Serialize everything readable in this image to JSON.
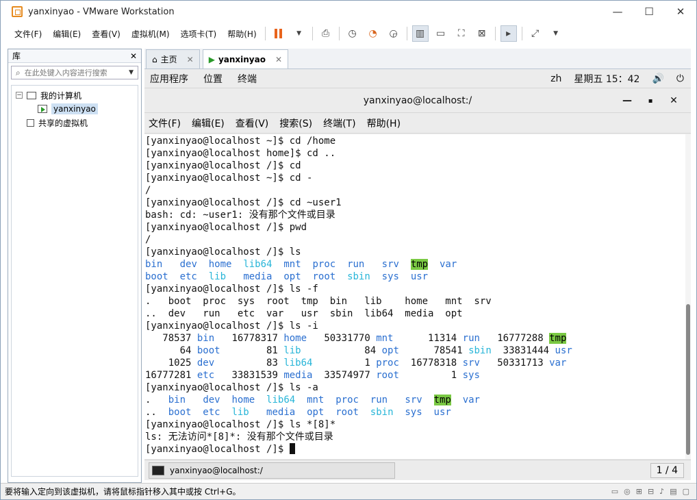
{
  "window": {
    "title": "yanxinyao - VMware Workstation"
  },
  "menubar": [
    "文件(F)",
    "编辑(E)",
    "查看(V)",
    "虚拟机(M)",
    "选项卡(T)",
    "帮助(H)"
  ],
  "library": {
    "title": "库",
    "search_placeholder": "在此处键入内容进行搜索",
    "tree": {
      "my_computer": "我的计算机",
      "vm": "yanxinyao",
      "shared": "共享的虚拟机"
    }
  },
  "tabs": [
    {
      "label": "主页"
    },
    {
      "label": "yanxinyao"
    }
  ],
  "gnome": {
    "apps": "应用程序",
    "places": "位置",
    "terminal": "终端",
    "lang": "zh",
    "clock": "星期五 15：42"
  },
  "terminal": {
    "title": "yanxinyao@localhost:/",
    "menu": [
      "文件(F)",
      "编辑(E)",
      "查看(V)",
      "搜索(S)",
      "终端(T)",
      "帮助(H)"
    ],
    "lines": [
      [
        {
          "t": "[yanxinyao@localhost ~]$ cd /home"
        }
      ],
      [
        {
          "t": "[yanxinyao@localhost home]$ cd .."
        }
      ],
      [
        {
          "t": "[yanxinyao@localhost /]$ cd"
        }
      ],
      [
        {
          "t": "[yanxinyao@localhost ~]$ cd -"
        }
      ],
      [
        {
          "t": "/"
        }
      ],
      [
        {
          "t": "[yanxinyao@localhost /]$ cd ~user1"
        }
      ],
      [
        {
          "t": "bash: cd: ~user1: 没有那个文件或目录"
        }
      ],
      [
        {
          "t": "[yanxinyao@localhost /]$ pwd"
        }
      ],
      [
        {
          "t": "/"
        }
      ],
      [
        {
          "t": "[yanxinyao@localhost /]$ ls"
        }
      ],
      [
        {
          "t": "bin",
          "c": "blue"
        },
        {
          "t": "   "
        },
        {
          "t": "dev",
          "c": "blue"
        },
        {
          "t": "  "
        },
        {
          "t": "home",
          "c": "blue"
        },
        {
          "t": "  "
        },
        {
          "t": "lib64",
          "c": "cyan"
        },
        {
          "t": "  "
        },
        {
          "t": "mnt",
          "c": "blue"
        },
        {
          "t": "  "
        },
        {
          "t": "proc",
          "c": "blue"
        },
        {
          "t": "  "
        },
        {
          "t": "run",
          "c": "blue"
        },
        {
          "t": "   "
        },
        {
          "t": "srv",
          "c": "blue"
        },
        {
          "t": "  "
        },
        {
          "t": "tmp",
          "c": "tmp"
        },
        {
          "t": "  "
        },
        {
          "t": "var",
          "c": "blue"
        }
      ],
      [
        {
          "t": "boot",
          "c": "blue"
        },
        {
          "t": "  "
        },
        {
          "t": "etc",
          "c": "blue"
        },
        {
          "t": "  "
        },
        {
          "t": "lib",
          "c": "cyan"
        },
        {
          "t": "   "
        },
        {
          "t": "media",
          "c": "blue"
        },
        {
          "t": "  "
        },
        {
          "t": "opt",
          "c": "blue"
        },
        {
          "t": "  "
        },
        {
          "t": "root",
          "c": "blue"
        },
        {
          "t": "  "
        },
        {
          "t": "sbin",
          "c": "cyan"
        },
        {
          "t": "  "
        },
        {
          "t": "sys",
          "c": "blue"
        },
        {
          "t": "  "
        },
        {
          "t": "usr",
          "c": "blue"
        }
      ],
      [
        {
          "t": "[yanxinyao@localhost /]$ ls -f"
        }
      ],
      [
        {
          "t": ".   boot  proc  sys  root  tmp  bin   lib    home   mnt  srv"
        }
      ],
      [
        {
          "t": "..  dev   run   etc  var   usr  sbin  lib64  media  opt"
        }
      ],
      [
        {
          "t": "[yanxinyao@localhost /]$ ls -i"
        }
      ],
      [
        {
          "t": "   78537 "
        },
        {
          "t": "bin",
          "c": "blue"
        },
        {
          "t": "   16778317 "
        },
        {
          "t": "home",
          "c": "blue"
        },
        {
          "t": "   50331770 "
        },
        {
          "t": "mnt",
          "c": "blue"
        },
        {
          "t": "      11314 "
        },
        {
          "t": "run",
          "c": "blue"
        },
        {
          "t": "   16777288 "
        },
        {
          "t": "tmp",
          "c": "tmp"
        }
      ],
      [
        {
          "t": "      64 "
        },
        {
          "t": "boot",
          "c": "blue"
        },
        {
          "t": "        81 "
        },
        {
          "t": "lib",
          "c": "cyan"
        },
        {
          "t": "           84 "
        },
        {
          "t": "opt",
          "c": "blue"
        },
        {
          "t": "      78541 "
        },
        {
          "t": "sbin",
          "c": "cyan"
        },
        {
          "t": "  33831444 "
        },
        {
          "t": "usr",
          "c": "blue"
        }
      ],
      [
        {
          "t": "    1025 "
        },
        {
          "t": "dev",
          "c": "blue"
        },
        {
          "t": "         83 "
        },
        {
          "t": "lib64",
          "c": "cyan"
        },
        {
          "t": "         1 "
        },
        {
          "t": "proc",
          "c": "blue"
        },
        {
          "t": "  16778318 "
        },
        {
          "t": "srv",
          "c": "blue"
        },
        {
          "t": "   50331713 "
        },
        {
          "t": "var",
          "c": "blue"
        }
      ],
      [
        {
          "t": "16777281 "
        },
        {
          "t": "etc",
          "c": "blue"
        },
        {
          "t": "   33831539 "
        },
        {
          "t": "media",
          "c": "blue"
        },
        {
          "t": "  33574977 "
        },
        {
          "t": "root",
          "c": "blue"
        },
        {
          "t": "         1 "
        },
        {
          "t": "sys",
          "c": "blue"
        }
      ],
      [
        {
          "t": "[yanxinyao@localhost /]$ ls -a"
        }
      ],
      [
        {
          "t": ".   "
        },
        {
          "t": "bin",
          "c": "blue"
        },
        {
          "t": "   "
        },
        {
          "t": "dev",
          "c": "blue"
        },
        {
          "t": "  "
        },
        {
          "t": "home",
          "c": "blue"
        },
        {
          "t": "  "
        },
        {
          "t": "lib64",
          "c": "cyan"
        },
        {
          "t": "  "
        },
        {
          "t": "mnt",
          "c": "blue"
        },
        {
          "t": "  "
        },
        {
          "t": "proc",
          "c": "blue"
        },
        {
          "t": "  "
        },
        {
          "t": "run",
          "c": "blue"
        },
        {
          "t": "   "
        },
        {
          "t": "srv",
          "c": "blue"
        },
        {
          "t": "  "
        },
        {
          "t": "tmp",
          "c": "tmp"
        },
        {
          "t": "  "
        },
        {
          "t": "var",
          "c": "blue"
        }
      ],
      [
        {
          "t": "..  "
        },
        {
          "t": "boot",
          "c": "blue"
        },
        {
          "t": "  "
        },
        {
          "t": "etc",
          "c": "blue"
        },
        {
          "t": "  "
        },
        {
          "t": "lib",
          "c": "cyan"
        },
        {
          "t": "   "
        },
        {
          "t": "media",
          "c": "blue"
        },
        {
          "t": "  "
        },
        {
          "t": "opt",
          "c": "blue"
        },
        {
          "t": "  "
        },
        {
          "t": "root",
          "c": "blue"
        },
        {
          "t": "  "
        },
        {
          "t": "sbin",
          "c": "cyan"
        },
        {
          "t": "  "
        },
        {
          "t": "sys",
          "c": "blue"
        },
        {
          "t": "  "
        },
        {
          "t": "usr",
          "c": "blue"
        }
      ],
      [
        {
          "t": "[yanxinyao@localhost /]$ ls *[8]*"
        }
      ],
      [
        {
          "t": "ls: 无法访问*[8]*: 没有那个文件或目录"
        }
      ],
      [
        {
          "t": "[yanxinyao@localhost /]$ "
        },
        {
          "c": "cursor"
        }
      ]
    ]
  },
  "taskbar": {
    "item": "yanxinyao@localhost:/",
    "pager": "1 / 4"
  },
  "statusbar": {
    "message": "要将输入定向到该虚拟机，请将鼠标指针移入其中或按 Ctrl+G。"
  }
}
